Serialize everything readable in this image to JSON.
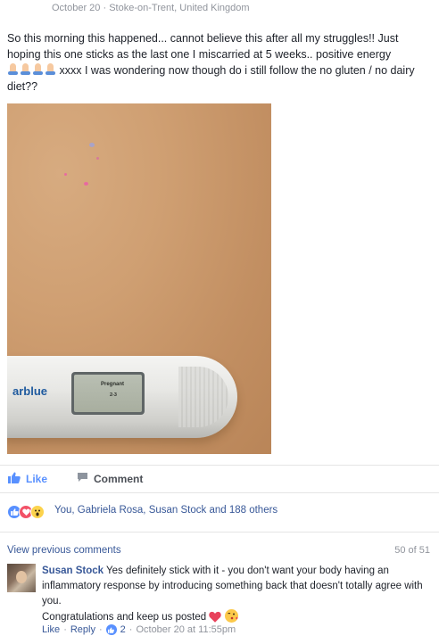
{
  "post": {
    "date": "October 20",
    "separator": "·",
    "location": "Stoke-on-Trent, United Kingdom",
    "text_part1": "So this morning this happened... cannot believe this after all my struggles!! Just hoping this one sticks as the last one I miscarried at 5 weeks.. positive energy ",
    "text_part2": " xxxx I was wondering now though do i still follow the no gluten / no dairy diet??",
    "photo": {
      "brand": "arblue",
      "display_line1": "Pregnant",
      "display_line2": "2-3"
    }
  },
  "actions": {
    "like_label": "Like",
    "comment_label": "Comment"
  },
  "reactions": {
    "summary": "You, Gabriela Rosa, Susan Stock and 188 others"
  },
  "comments": {
    "view_previous": "View previous comments",
    "counter": "50 of 51",
    "items": [
      {
        "author": "Susan Stock",
        "text": "Yes definitely stick with it - you don't want your body having an inflammatory response by introducing something back that doesn't totally agree with you.",
        "text2": "Congratulations and keep us posted",
        "like_label": "Like",
        "reply_label": "Reply",
        "sep": "·",
        "like_count": "2",
        "timestamp": "October 20 at 11:55pm"
      }
    ]
  },
  "colors": {
    "link": "#385898",
    "like_blue": "#5890ff",
    "muted": "#90949c",
    "love": "#f25268"
  }
}
